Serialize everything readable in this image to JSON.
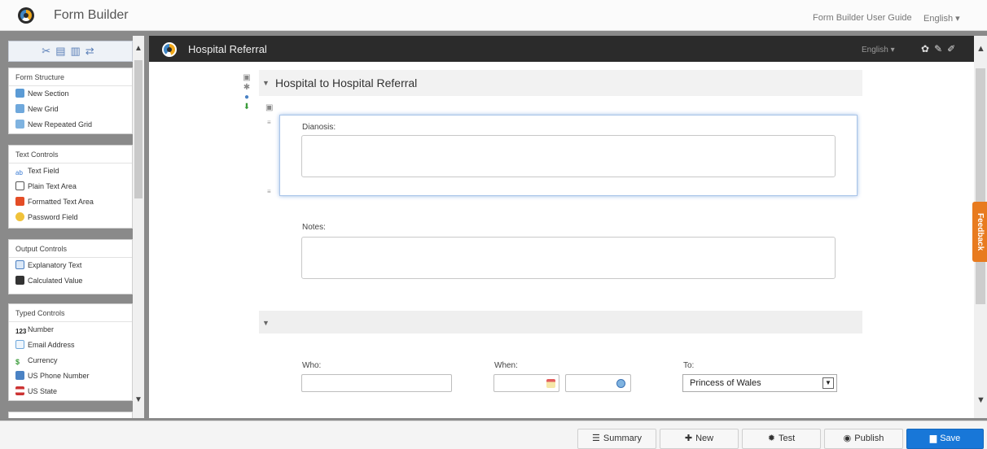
{
  "topbar": {
    "app_title": "Form Builder",
    "guide_link": "Form Builder User Guide",
    "language": "English ▾"
  },
  "palette": {
    "toolbar_icons": [
      "cut-icon",
      "copy-icon",
      "paste-icon",
      "refresh-icon"
    ],
    "groups": [
      {
        "title": "Form Structure",
        "items": [
          {
            "label": "New Section",
            "icon": "section-icon"
          },
          {
            "label": "New Grid",
            "icon": "grid-icon"
          },
          {
            "label": "New Repeated Grid",
            "icon": "repeated-grid-icon"
          }
        ]
      },
      {
        "title": "Text Controls",
        "items": [
          {
            "label": "Text Field",
            "icon": "text-field-icon"
          },
          {
            "label": "Plain Text Area",
            "icon": "plain-text-area-icon"
          },
          {
            "label": "Formatted Text Area",
            "icon": "html5-icon"
          },
          {
            "label": "Password Field",
            "icon": "key-icon"
          }
        ]
      },
      {
        "title": "Output Controls",
        "items": [
          {
            "label": "Explanatory Text",
            "icon": "explanatory-text-icon"
          },
          {
            "label": "Calculated Value",
            "icon": "calculator-icon"
          }
        ]
      },
      {
        "title": "Typed Controls",
        "items": [
          {
            "label": "Number",
            "icon": "number-icon"
          },
          {
            "label": "Email Address",
            "icon": "email-icon"
          },
          {
            "label": "Currency",
            "icon": "dollar-icon"
          },
          {
            "label": "US Phone Number",
            "icon": "phone-icon"
          },
          {
            "label": "US State",
            "icon": "us-flag-icon"
          }
        ]
      }
    ]
  },
  "editor": {
    "form_title": "Hospital Referral",
    "language": "English ▾",
    "header_icons": [
      "settings-icon",
      "edit-icon",
      "wrench-icon"
    ],
    "section1_title": "Hospital to Hospital Referral",
    "diagnosis_label": "Dianosis:",
    "notes_label": "Notes:",
    "who_label": "Who:",
    "when_label": "When:",
    "to_label": "To:",
    "to_value": "Princess of Wales"
  },
  "feedback_label": "Feedback",
  "bottombar": {
    "summary": "Summary",
    "new": "New",
    "test": "Test",
    "publish": "Publish",
    "save": "Save"
  },
  "colors": {
    "header_dark": "#2b2b2b",
    "save_blue": "#1877d8",
    "feedback_orange": "#e87b1f",
    "focus_blue": "#9dbbe6"
  }
}
